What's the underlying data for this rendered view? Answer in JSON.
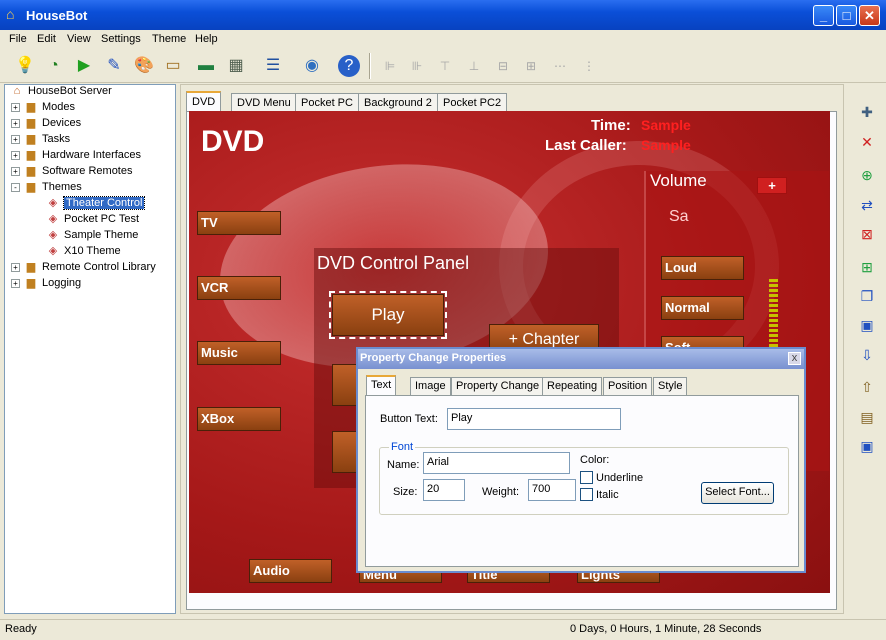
{
  "window": {
    "title": "HouseBot"
  },
  "menu": [
    "File",
    "Edit",
    "View",
    "Settings",
    "Theme",
    "Help"
  ],
  "tree": {
    "root": "HouseBot Server",
    "items": [
      {
        "label": "Modes",
        "expander": "+"
      },
      {
        "label": "Devices",
        "expander": "+"
      },
      {
        "label": "Tasks",
        "expander": "+"
      },
      {
        "label": "Hardware Interfaces",
        "expander": "+"
      },
      {
        "label": "Software Remotes",
        "expander": "+"
      },
      {
        "label": "Themes",
        "expander": "-"
      },
      {
        "label": "Theater Control",
        "child": true,
        "selected": true
      },
      {
        "label": "Pocket PC Test",
        "child": true
      },
      {
        "label": "Sample Theme",
        "child": true
      },
      {
        "label": "X10 Theme",
        "child": true
      },
      {
        "label": "Remote Control Library",
        "expander": "+"
      },
      {
        "label": "Logging",
        "expander": "+"
      }
    ]
  },
  "tabs": [
    "DVD",
    "DVD Menu",
    "Pocket PC",
    "Background 2",
    "Pocket PC2"
  ],
  "theme": {
    "title": "DVD",
    "time_label": "Time:",
    "time_value": "Sample",
    "caller_label": "Last Caller:",
    "caller_value": "Sample",
    "volume_label": "Volume",
    "volume_plus": "+",
    "sample_partial": "Sa",
    "left_buttons": [
      "TV",
      "VCR",
      "Music",
      "XBox"
    ],
    "panel_title": "DVD Control Panel",
    "play": "Play",
    "chapter": "+ Chapter",
    "volume_buttons": [
      "Loud",
      "Normal",
      "Soft"
    ],
    "bottom_buttons": [
      "Audio",
      "Menu",
      "Title",
      "Lights"
    ]
  },
  "dialog": {
    "title": "Property Change Properties",
    "close": "x",
    "tabs": [
      "Text",
      "Image",
      "Property Change",
      "Repeating",
      "Position",
      "Style"
    ],
    "button_text_label": "Button Text:",
    "button_text_value": "Play",
    "font_group": "Font",
    "name_label": "Name:",
    "name_value": "Arial",
    "size_label": "Size:",
    "size_value": "20",
    "weight_label": "Weight:",
    "weight_value": "700",
    "color_label": "Color:",
    "underline_label": "Underline",
    "italic_label": "Italic",
    "select_font": "Select Font..."
  },
  "colors": {
    "canvas": "#a51818",
    "accent_red": "#ff2020",
    "button_brown": "#a85018"
  },
  "status": {
    "left": "Ready",
    "right": "0 Days, 0 Hours, 1 Minute, 28 Seconds"
  }
}
